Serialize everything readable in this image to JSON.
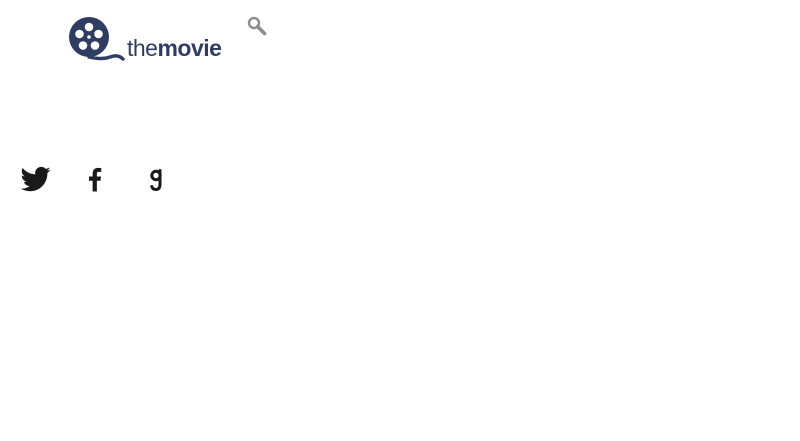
{
  "brand": {
    "logo_the": "the",
    "logo_movie": "movie",
    "logo_color": "#2f3d62"
  },
  "header": {
    "search_icon": "magnifier-icon",
    "search_icon_color": "#8c8c8c"
  },
  "social": [
    {
      "icon": "twitter-bird-icon"
    },
    {
      "icon": "facebook-f-icon"
    },
    {
      "icon": "goodreads-g-icon"
    }
  ]
}
